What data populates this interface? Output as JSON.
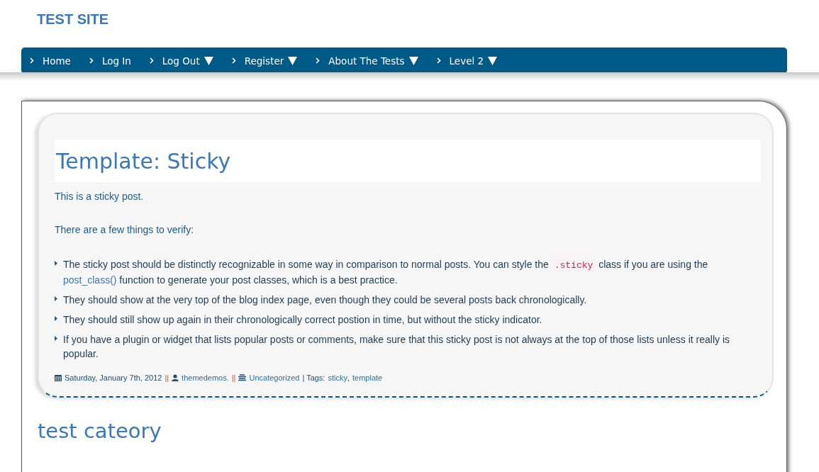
{
  "site_title": "TEST SITE",
  "nav": [
    {
      "label": "Home",
      "has_dropdown": false
    },
    {
      "label": "Log In",
      "has_dropdown": false
    },
    {
      "label": "Log Out",
      "has_dropdown": true
    },
    {
      "label": "Register",
      "has_dropdown": true
    },
    {
      "label": "About The Tests",
      "has_dropdown": true
    },
    {
      "label": "Level 2",
      "has_dropdown": true
    }
  ],
  "post": {
    "title": "Template: Sticky",
    "paragraphs": [
      "This is a sticky post.",
      "There are a few things to verify:"
    ],
    "bullets": [
      [
        {
          "kind": "text",
          "text": "The sticky post should be distinctly recognizable in some way in comparison to normal posts. You can style the "
        },
        {
          "kind": "code",
          "text": ".sticky"
        },
        {
          "kind": "text",
          "text": " class if you are using the "
        },
        {
          "kind": "link",
          "text": "post_class()"
        },
        {
          "kind": "text",
          "text": " function to generate your post classes, which is a best practice."
        }
      ],
      [
        {
          "kind": "text",
          "text": "They should show at the very top of the blog index page, even though they could be several posts back chronologically."
        }
      ],
      [
        {
          "kind": "text",
          "text": "They should still show up again in their chronologically correct postion in time, but without the sticky indicator."
        }
      ],
      [
        {
          "kind": "text",
          "text": "If you have a plugin or widget that lists popular posts or comments, make sure that this sticky post is not always at the top of those lists unless it really is popular."
        }
      ]
    ],
    "meta": {
      "date": "Saturday, January 7th, 2012",
      "sep1": "||",
      "author": "themedemos.",
      "sep2": "||",
      "category": "Uncategorized",
      "tags_label": "| Tags:",
      "tag_separator": ",",
      "tags": [
        "sticky",
        "template"
      ]
    }
  },
  "section_title": "test cateory"
}
